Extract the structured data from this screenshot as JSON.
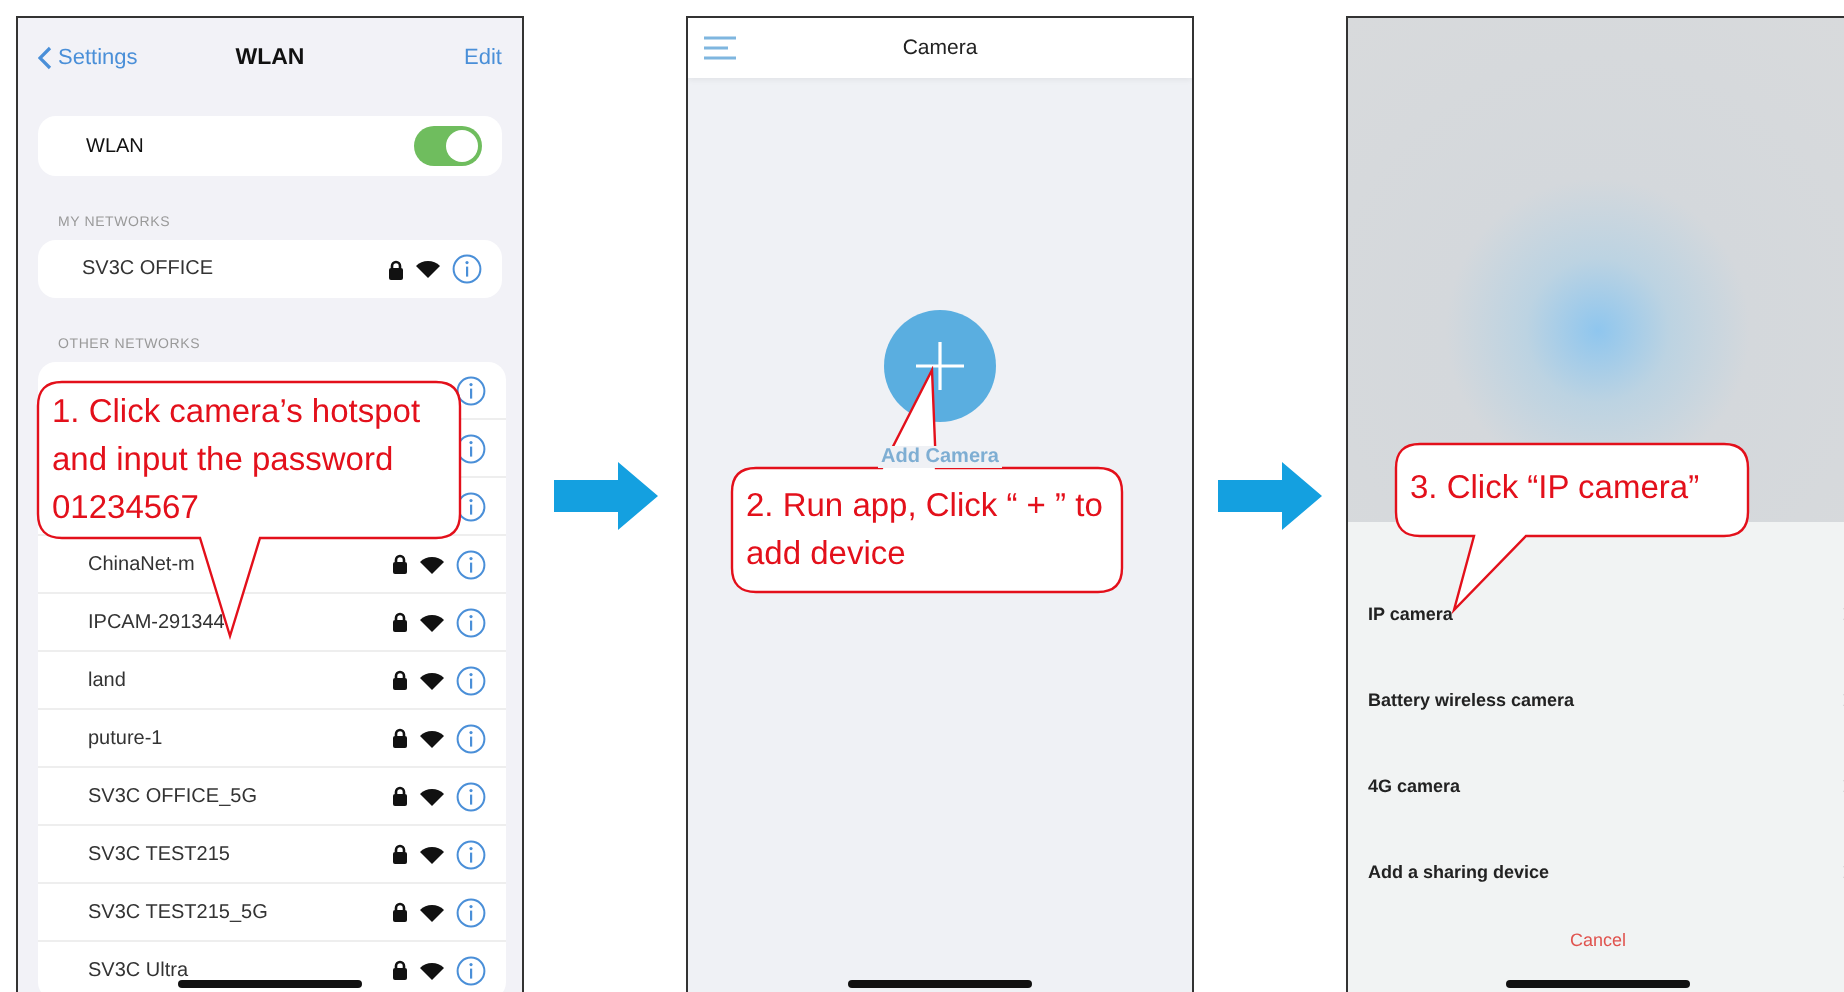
{
  "wlan_screen": {
    "back": "Settings",
    "title": "WLAN",
    "edit": "Edit",
    "wlan_label": "WLAN",
    "wlan_on": true,
    "my_networks_header": "MY NETWORKS",
    "my_networks": [
      {
        "name": "SV3C OFFICE"
      }
    ],
    "other_networks_header": "OTHER NETWORKS",
    "other_networks": [
      {
        "kind": "covered"
      },
      {
        "kind": "covered"
      },
      {
        "kind": "covered"
      },
      {
        "kind": "network",
        "name": "ChinaNet-m"
      },
      {
        "kind": "network",
        "name": "IPCAM-291344"
      },
      {
        "kind": "network",
        "name": "land"
      },
      {
        "kind": "network",
        "name": "puture-1"
      },
      {
        "kind": "network",
        "name": "SV3C OFFICE_5G"
      },
      {
        "kind": "network",
        "name": "SV3C TEST215"
      },
      {
        "kind": "network",
        "name": "SV3C TEST215_5G"
      },
      {
        "kind": "network",
        "name": "SV3C Ultra"
      }
    ]
  },
  "camera_screen": {
    "title": "Camera",
    "add_label": "Add Camera"
  },
  "add_device_sheet": {
    "options": [
      {
        "label": "IP camera"
      },
      {
        "label": "Battery wireless camera"
      },
      {
        "label": "4G camera"
      },
      {
        "label": "Add a sharing device"
      }
    ],
    "cancel": "Cancel"
  },
  "callouts": [
    {
      "text": "1. Click camera’s hotspot and input the password 01234567"
    },
    {
      "text": "2. Run app, Click “ + ” to add device"
    },
    {
      "text": "3. Click “IP camera”"
    }
  ]
}
